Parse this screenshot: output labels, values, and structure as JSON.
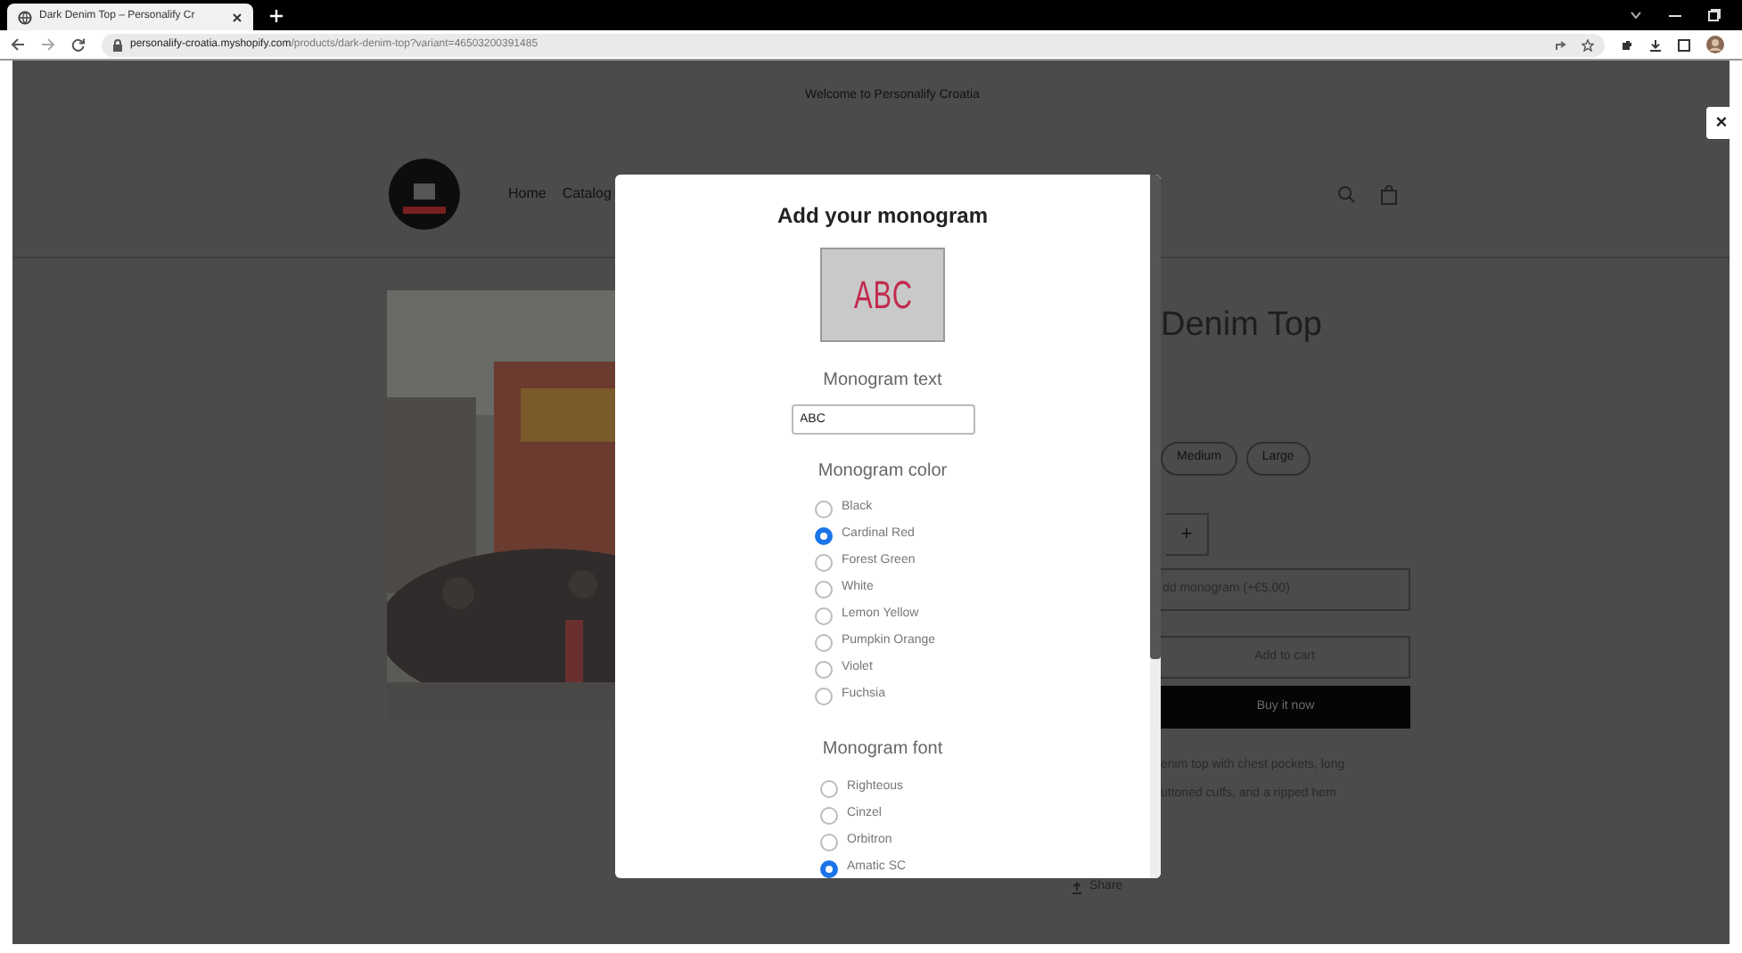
{
  "browser": {
    "tab_title": "Dark Denim Top – Personalify Cr",
    "url_host": "personalify-croatia.myshopify.com",
    "url_path": "/products/dark-denim-top?variant=46503200391485"
  },
  "announcement": "Welcome to Personalify Croatia",
  "nav": [
    {
      "label": "Home"
    },
    {
      "label": "Catalog"
    }
  ],
  "product": {
    "title": "Denim Top",
    "sizes": [
      {
        "label": "Medium",
        "selected": false
      },
      {
        "label": "Large",
        "selected": false
      }
    ],
    "quantity_plus": "+",
    "monogram_button": "dd monogram (+€5,00)",
    "add_to_cart": "Add to cart",
    "buy_now": "Buy it now",
    "description": [
      "enim top with chest pockets, long",
      "uttoned cuffs, and a ripped hem"
    ],
    "share": "Share"
  },
  "modal": {
    "title": "Add your monogram",
    "preview": "ABC",
    "text_label": "Monogram text",
    "text_value": "ABC",
    "color_label": "Monogram color",
    "colors": [
      {
        "label": "Black",
        "selected": false
      },
      {
        "label": "Cardinal Red",
        "selected": true
      },
      {
        "label": "Forest Green",
        "selected": false
      },
      {
        "label": "White",
        "selected": false
      },
      {
        "label": "Lemon Yellow",
        "selected": false
      },
      {
        "label": "Pumpkin Orange",
        "selected": false
      },
      {
        "label": "Violet",
        "selected": false
      },
      {
        "label": "Fuchsia",
        "selected": false
      }
    ],
    "font_label": "Monogram font",
    "fonts": [
      {
        "label": "Righteous",
        "selected": false
      },
      {
        "label": "Cinzel",
        "selected": false
      },
      {
        "label": "Orbitron",
        "selected": false
      },
      {
        "label": "Amatic SC",
        "selected": true
      }
    ]
  },
  "close_button": "×"
}
